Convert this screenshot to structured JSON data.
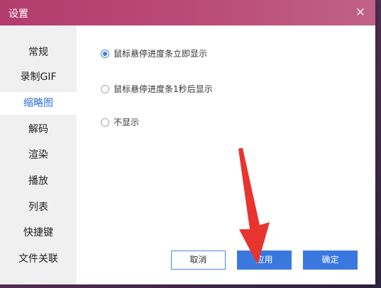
{
  "window": {
    "title": "设置",
    "close_glyph": "✕"
  },
  "sidebar": {
    "items": [
      {
        "label": "常规"
      },
      {
        "label": "录制GIF"
      },
      {
        "label": "缩略图",
        "active": true
      },
      {
        "label": "解码"
      },
      {
        "label": "渲染"
      },
      {
        "label": "播放"
      },
      {
        "label": "列表"
      },
      {
        "label": "快捷键"
      },
      {
        "label": "文件关联"
      }
    ]
  },
  "options": [
    {
      "label": "鼠标悬停进度条立即显示",
      "checked": true
    },
    {
      "label": "鼠标悬停进度条1秒后显示",
      "checked": false
    },
    {
      "label": "不显示",
      "checked": false
    }
  ],
  "buttons": {
    "cancel": "取消",
    "apply": "应用",
    "ok": "确定"
  },
  "colors": {
    "accent": "#3a78e0",
    "titlebar": "#b7416f",
    "arrow": "#e8342f"
  }
}
